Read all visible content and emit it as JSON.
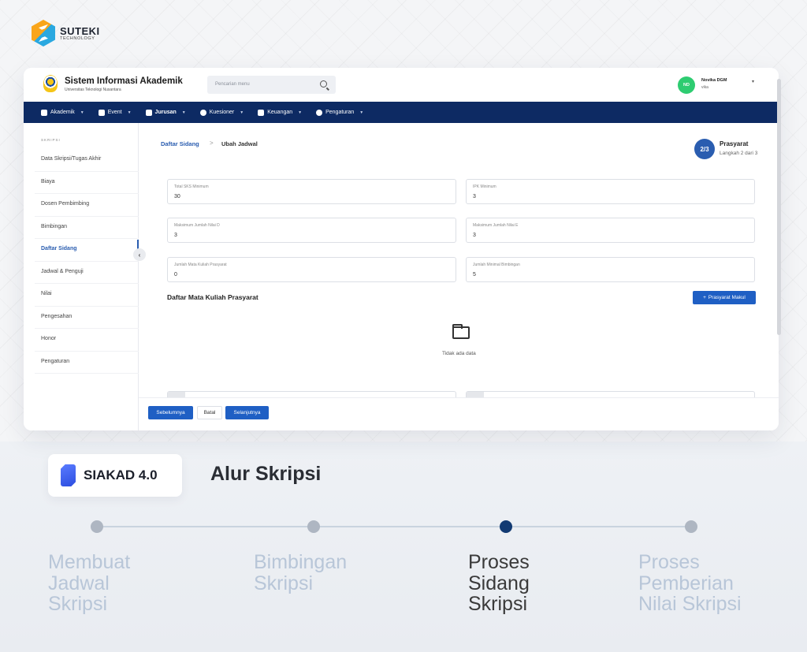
{
  "brand": {
    "name": "SUTEKI",
    "tagline": "TECHNOLOGY"
  },
  "app": {
    "title": "Sistem Informasi Akademik",
    "subtitle": "Universitas Teknologi Nusantara",
    "search_placeholder": "Pencarian menu",
    "user": {
      "initials": "ND",
      "name": "Novika DGM",
      "role": "vika"
    }
  },
  "nav": [
    {
      "label": "Akademik",
      "icon": "building-icon"
    },
    {
      "label": "Event",
      "icon": "calendar-icon"
    },
    {
      "label": "Jurusan",
      "icon": "graduation-icon",
      "active": true
    },
    {
      "label": "Kuesioner",
      "icon": "chat-icon"
    },
    {
      "label": "Keuangan",
      "icon": "wallet-icon"
    },
    {
      "label": "Pengaturan",
      "icon": "gear-icon"
    }
  ],
  "sidebar": {
    "group_label": "SKRIPSI",
    "items": [
      {
        "label": "Data Skripsi/Tugas Akhir"
      },
      {
        "label": "Biaya"
      },
      {
        "label": "Dosen Pembimbing"
      },
      {
        "label": "Bimbingan"
      },
      {
        "label": "Daftar Sidang",
        "active": true
      },
      {
        "label": "Jadwal & Penguji"
      },
      {
        "label": "Nilai"
      },
      {
        "label": "Pengesahan"
      },
      {
        "label": "Honor"
      },
      {
        "label": "Pengaturan"
      }
    ]
  },
  "breadcrumb": {
    "root": "Daftar Sidang",
    "separator": ">",
    "current": "Ubah Jadwal"
  },
  "step": {
    "badge": "2/3",
    "title": "Prasyarat",
    "subtitle": "Langkah 2 dari 3"
  },
  "fields": [
    {
      "label": "Total SKS Minimum",
      "value": "30"
    },
    {
      "label": "IPK Minimum",
      "value": "3"
    },
    {
      "label": "Maksimum Jumlah Nilai D",
      "value": "3"
    },
    {
      "label": "Maksimum Jumlah Nilai E",
      "value": "3"
    },
    {
      "label": "Jumlah Mata Kuliah Prasyarat",
      "value": "0"
    },
    {
      "label": "Jumlah Minimal Bimbingan",
      "value": "5"
    }
  ],
  "course_list": {
    "title": "Daftar Mata Kuliah Prasyarat",
    "add_button": "Prasyarat Makul",
    "add_icon": "+",
    "empty_text": "Tidak ada data"
  },
  "footer": {
    "prev": "Sebelumnya",
    "cancel": "Batal",
    "next": "Selanjutnya"
  },
  "product": {
    "name": "SIAKAD 4.0"
  },
  "flow": {
    "title": "Alur Skripsi",
    "steps": [
      {
        "lines": [
          "Membuat",
          "Jadwal",
          "Skripsi"
        ]
      },
      {
        "lines": [
          "Bimbingan",
          "Skripsi"
        ]
      },
      {
        "lines": [
          "Proses",
          "Sidang",
          "Skripsi"
        ],
        "active": true
      },
      {
        "lines": [
          "Proses",
          "Pemberian",
          "Nilai Skripsi"
        ]
      }
    ]
  },
  "colors": {
    "navy": "#0d2a63",
    "primary": "#1f5fc4",
    "accent": "#2a5db0",
    "avatar": "#2ecc71",
    "timeline_active": "#123a72"
  }
}
